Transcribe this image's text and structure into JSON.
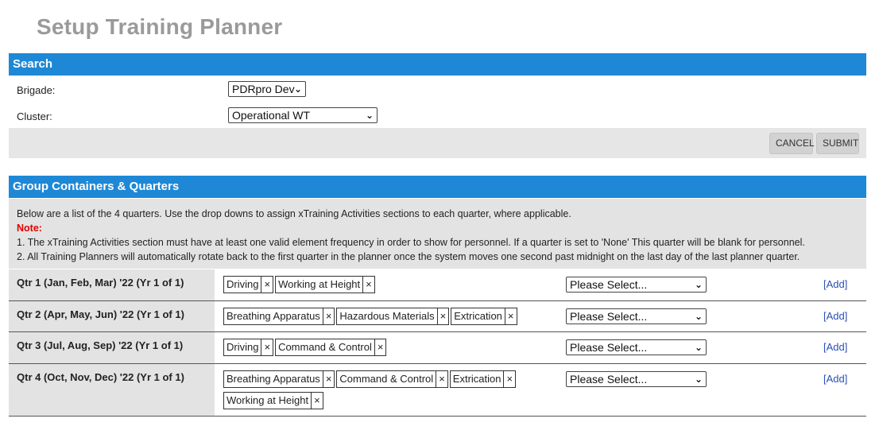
{
  "page": {
    "title": "Setup Training Planner"
  },
  "search": {
    "header": "Search",
    "brigade_label": "Brigade:",
    "brigade_value": "PDRpro Dev",
    "cluster_label": "Cluster:",
    "cluster_value": "Operational WT",
    "cancel_label": "CANCEL",
    "submit_label": "SUBMIT"
  },
  "groups": {
    "header": "Group Containers & Quarters",
    "intro": "Below are a list of the 4 quarters. Use the drop downs to assign xTraining Activities sections to each quarter, where applicable.",
    "note_label": "Note:",
    "note_1": "1. The xTraining Activities section must have at least one valid element frequency in order to show for personnel. If a quarter is set to 'None' This quarter will be blank for personnel.",
    "note_2": "2. All Training Planners will automatically rotate back to the first quarter in the planner once the system moves one second past midnight on the last day of the last planner quarter."
  },
  "quarters": [
    {
      "label": "Qtr 1 (Jan, Feb, Mar) '22 (Yr 1 of 1)",
      "tags": [
        "Driving",
        "Working at Height"
      ],
      "select": "Please Select...",
      "add": "[Add]"
    },
    {
      "label": "Qtr 2 (Apr, May, Jun) '22 (Yr 1 of 1)",
      "tags": [
        "Breathing Apparatus",
        "Hazardous Materials",
        "Extrication"
      ],
      "select": "Please Select...",
      "add": "[Add]"
    },
    {
      "label": "Qtr 3 (Jul, Aug, Sep) '22 (Yr 1 of 1)",
      "tags": [
        "Driving",
        "Command & Control"
      ],
      "select": "Please Select...",
      "add": "[Add]"
    },
    {
      "label": "Qtr 4 (Oct, Nov, Dec) '22 (Yr 1 of 1)",
      "tags": [
        "Breathing Apparatus",
        "Command & Control",
        "Extrication",
        "Working at Height"
      ],
      "select": "Please Select...",
      "add": "[Add]"
    }
  ],
  "icons": {
    "remove": "×",
    "dropdown": "chevron-down-icon"
  }
}
